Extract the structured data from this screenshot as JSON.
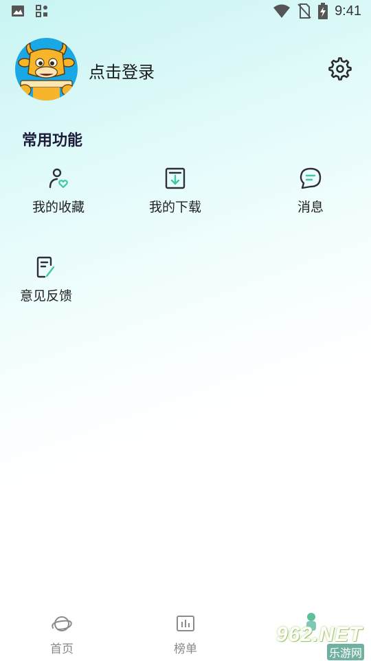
{
  "status_bar": {
    "time": "9:41",
    "left_icons": [
      "image-icon",
      "apps-icon"
    ],
    "right_icons": [
      "wifi-icon",
      "no-sim-icon",
      "battery-charging-icon"
    ]
  },
  "profile": {
    "login_label": "点击登录",
    "avatar_icon": "bull-avatar-icon",
    "settings_icon": "gear-icon"
  },
  "section": {
    "title": "常用功能"
  },
  "functions": [
    {
      "label": "我的收藏",
      "icon": "favorite-user-icon"
    },
    {
      "label": "我的下载",
      "icon": "download-icon"
    },
    {
      "label": "消息",
      "icon": "message-icon"
    },
    {
      "label": "意见反馈",
      "icon": "feedback-icon"
    }
  ],
  "tabs": [
    {
      "label": "首页",
      "icon": "planet-icon"
    },
    {
      "label": "榜单",
      "icon": "chart-icon"
    }
  ],
  "watermark": {
    "main": "962.NET",
    "sub": "乐游网"
  },
  "colors": {
    "accent_green": "#3fc8a2",
    "icon_dark": "#2e2e3a",
    "avatar_bg": "#1aa7e6",
    "bull_yellow": "#f6b52a"
  }
}
